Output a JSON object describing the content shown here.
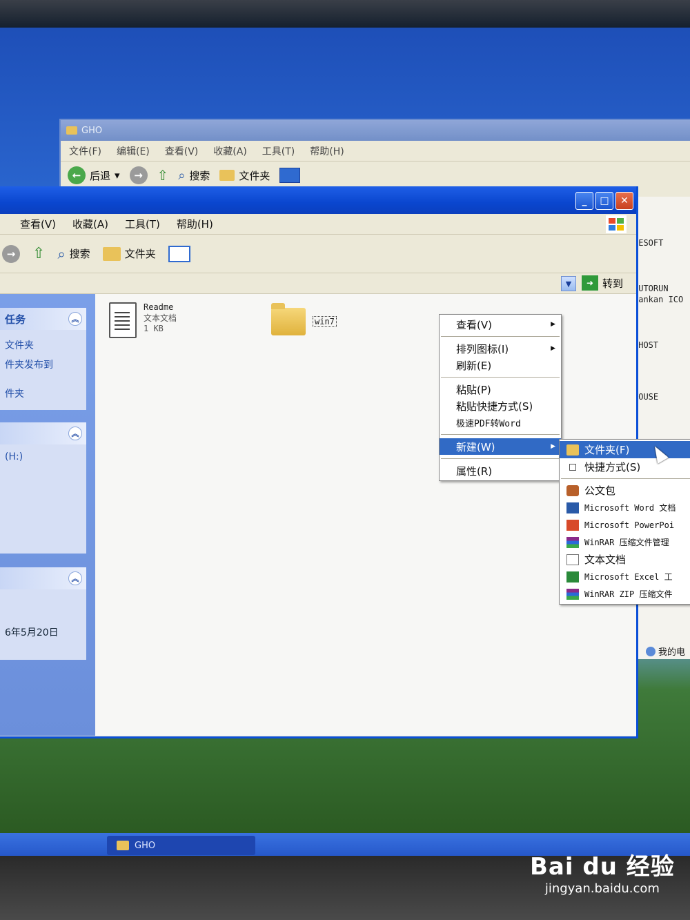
{
  "back_window": {
    "title": "GHO",
    "menu": [
      "文件(F)",
      "编辑(E)",
      "查看(V)",
      "收藏(A)",
      "工具(T)",
      "帮助(H)"
    ],
    "toolbar": {
      "back": "后退",
      "search": "搜索",
      "folders": "文件夹"
    }
  },
  "side_strip": {
    "lines": [
      "PESOFT",
      "AUTORUN",
      "Xankan ICO",
      "GHOST",
      "MOUSE"
    ],
    "my_computer": "我的电"
  },
  "front_window": {
    "menu": [
      "查看(V)",
      "收藏(A)",
      "工具(T)",
      "帮助(H)"
    ],
    "toolbar": {
      "search": "搜索",
      "folders": "文件夹"
    },
    "address": {
      "go_label": "转到"
    },
    "task_pane": {
      "box1_title": "任务",
      "box1_links": [
        "文件夹",
        "件夹发布到",
        "件夹"
      ],
      "box2_link": "(H:)",
      "box3_text": "6年5月20日"
    },
    "files": [
      {
        "name": "Readme",
        "type": "文本文档",
        "size": "1 KB"
      },
      {
        "name": "win7"
      }
    ]
  },
  "context_menu": {
    "view": "查看(V)",
    "arrange": "排列图标(I)",
    "refresh": "刷新(E)",
    "paste": "粘贴(P)",
    "paste_shortcut": "粘贴快捷方式(S)",
    "pdf_to_word": "极速PDF转Word",
    "new": "新建(W)",
    "properties": "属性(R)"
  },
  "new_submenu": [
    {
      "label": "文件夹(F)",
      "icon": "folder-icon"
    },
    {
      "label": "快捷方式(S)",
      "icon": "shortcut-icon"
    },
    {
      "label": "公文包",
      "icon": "briefcase-icon"
    },
    {
      "label": "Microsoft Word 文档",
      "icon": "word-icon"
    },
    {
      "label": "Microsoft PowerPoi",
      "icon": "powerpoint-icon"
    },
    {
      "label": "WinRAR 压缩文件管理",
      "icon": "winrar-icon"
    },
    {
      "label": "文本文档",
      "icon": "text-document-icon"
    },
    {
      "label": "Microsoft Excel 工",
      "icon": "excel-icon"
    },
    {
      "label": "WinRAR ZIP 压缩文件",
      "icon": "winrar-zip-icon"
    }
  ],
  "taskbar": {
    "task_label": "GHO"
  },
  "watermark": {
    "logo": "Bai du 经验",
    "url": "jingyan.baidu.com"
  }
}
